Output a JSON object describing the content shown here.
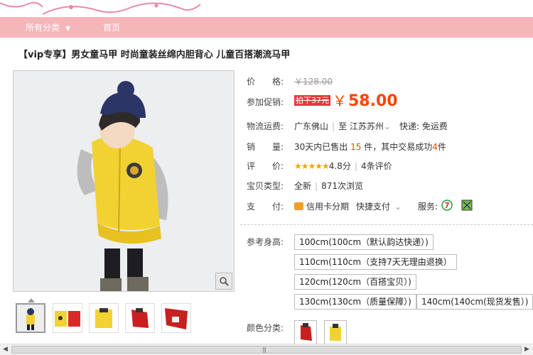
{
  "nav": {
    "category_label": "所有分类",
    "category_caret": "▼",
    "home_label": "首页"
  },
  "product": {
    "title": "【vip专享】男女童马甲 时尚童装丝绵内胆背心 儿童百搭潮流马甲"
  },
  "price": {
    "label": "价　　格:",
    "original": "￥128.00",
    "promo_label": "参加促销:",
    "promo_tag": "拍下37元",
    "promo_currency": "￥",
    "promo_value": "58.00"
  },
  "shipping": {
    "label": "物流运费:",
    "origin": "广东佛山",
    "to_prefix": "至",
    "destination": "江苏苏州",
    "destination_caret": "⌄",
    "fee": "快递: 免运费"
  },
  "sales": {
    "label": "销　　量:",
    "prefix": "30天内已售出",
    "sold_count": "15",
    "mid": "件，其中交易成功",
    "success_count": "4",
    "suffix": "件"
  },
  "rating": {
    "label": "评　　价:",
    "stars": "★★★★★",
    "score": "4.8分",
    "reviews": "4条评价"
  },
  "type": {
    "label": "宝贝类型:",
    "condition": "全新",
    "views": "871次浏览"
  },
  "payment": {
    "label": "支　　付:",
    "credit": "信用卡分期",
    "quick": "快捷支付",
    "quick_caret": "⌄",
    "service_label": "服务:"
  },
  "sizes": {
    "label": "参考身高:",
    "options": [
      "100cm(100cm（默认韵达快递）)",
      "110cm(110cm（支持7天无理由退换）",
      "120cm(120cm（百搭宝贝）)",
      "130cm(130cm（质量保障）)",
      "140cm(140cm(现货发售）)"
    ]
  },
  "colors": {
    "label": "颜色分类:"
  },
  "icons": {
    "zoom": "magnifier-icon",
    "service_7day": "seven-day-return-icon",
    "service_guarantee": "guarantee-icon"
  },
  "scrollbar": {
    "left_arrow": "◀",
    "right_arrow": "▶",
    "grip": "|||"
  },
  "theme": {
    "nav_bg": "#f5b6b9",
    "price_color": "#ff4400",
    "promo_tag_bg": "#e4393c",
    "star_color": "#f6a400"
  }
}
